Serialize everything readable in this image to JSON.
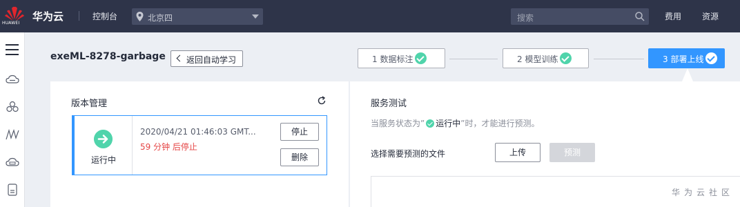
{
  "header": {
    "logo_text": "HUAWEI",
    "brand": "华为云",
    "console": "控制台",
    "region": "北京四",
    "search_placeholder": "搜索",
    "nav": {
      "fees": "费用",
      "resources": "资源"
    }
  },
  "page": {
    "title": "exeML-8278-garbage",
    "back_label": "返回自动学习",
    "steps": [
      {
        "label": "1 数据标注",
        "done": true,
        "active": false
      },
      {
        "label": "2 模型训练",
        "done": true,
        "active": false
      },
      {
        "label": "3 部署上线",
        "done": true,
        "active": true
      }
    ]
  },
  "version_panel": {
    "title": "版本管理",
    "version": {
      "status": "运行中",
      "time": "2020/04/21 01:46:03 GMT...",
      "stop_info": "59 分钟 后停止",
      "stop_button": "停止",
      "delete_button": "删除"
    }
  },
  "service_panel": {
    "title": "服务测试",
    "hint_prefix": "当服务状态为”",
    "hint_status": "运行中",
    "hint_suffix": "”时，才能进行预测。",
    "file_label": "选择需要预测的文件",
    "upload_button": "上传",
    "predict_button": "预测",
    "watermark": "华为云社区"
  },
  "colors": {
    "topbar": "#2e3449",
    "accent": "#3296ff",
    "success": "#50d4ab",
    "danger": "#e54545"
  },
  "icons": [
    "huawei-logo",
    "location-pin-icon",
    "search-icon",
    "menu-icon",
    "refresh-icon",
    "arrow-right-icon",
    "check-icon",
    "chevron-left-icon"
  ]
}
